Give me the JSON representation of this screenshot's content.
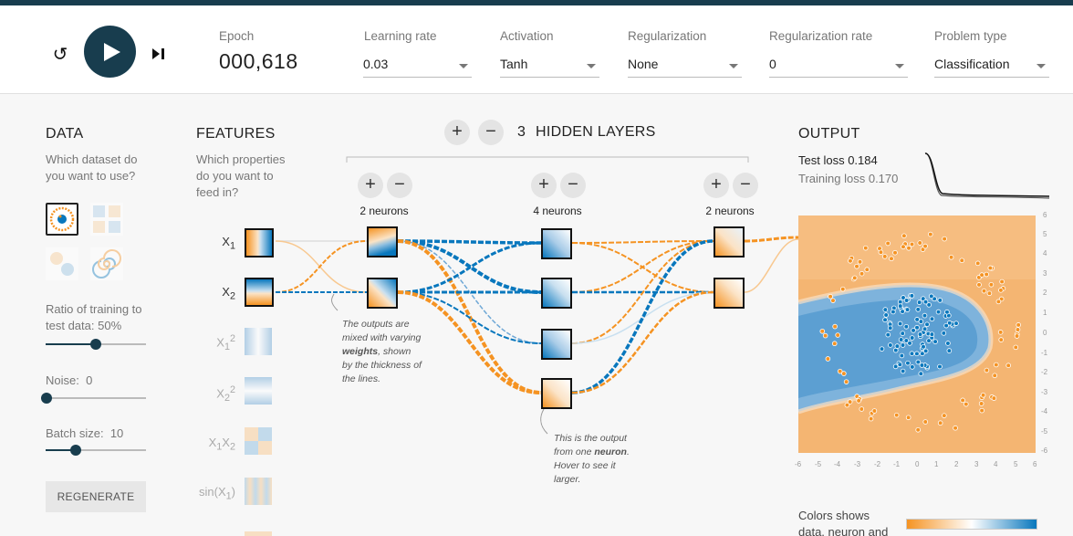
{
  "header": {
    "epoch_label": "Epoch",
    "epoch_value": "000,618",
    "learning_rate": {
      "label": "Learning rate",
      "value": "0.03"
    },
    "activation": {
      "label": "Activation",
      "value": "Tanh"
    },
    "regularization": {
      "label": "Regularization",
      "value": "None"
    },
    "regularization_rate": {
      "label": "Regularization rate",
      "value": "0"
    },
    "problem_type": {
      "label": "Problem type",
      "value": "Classification"
    }
  },
  "data_panel": {
    "title": "DATA",
    "question": "Which dataset do you want to use?",
    "ratio_label": "Ratio of training to test data:",
    "ratio_value": "50%",
    "ratio_fraction": 0.5,
    "noise_label": "Noise:",
    "noise_value": "0",
    "noise_fraction": 0,
    "batch_label": "Batch size:",
    "batch_value": "10",
    "batch_fraction": 0.3,
    "regenerate": "REGENERATE"
  },
  "features_panel": {
    "title": "FEATURES",
    "question": "Which properties do you want to feed in?",
    "features": [
      {
        "base": "X",
        "sub": "1",
        "sup": "",
        "active": true
      },
      {
        "base": "X",
        "sub": "2",
        "sup": "",
        "active": true
      },
      {
        "base": "X",
        "sub": "1",
        "sup": "2",
        "active": false
      },
      {
        "base": "X",
        "sub": "2",
        "sup": "2",
        "active": false
      },
      {
        "base": "X",
        "sub": "1",
        "base2": "X",
        "sub2": "2",
        "active": false
      },
      {
        "base": "sin(X",
        "sub": "1",
        "tail": ")",
        "active": false
      }
    ]
  },
  "network": {
    "hidden_layers_count": "3",
    "hidden_layers_label": "HIDDEN LAYERS",
    "layers": [
      {
        "neurons_label": "2 neurons"
      },
      {
        "neurons_label": "4 neurons"
      },
      {
        "neurons_label": "2 neurons"
      }
    ],
    "note_weights": [
      "The outputs are",
      "mixed with varying",
      "weights",
      ", shown",
      "by the thickness of",
      "the lines."
    ],
    "note_neuron": [
      "This is the output",
      "from one ",
      "neuron",
      ".",
      "Hover to see it",
      "larger."
    ]
  },
  "output_panel": {
    "title": "OUTPUT",
    "test_loss_label": "Test loss",
    "test_loss_value": "0.184",
    "training_loss_label": "Training loss",
    "training_loss_value": "0.170",
    "y_ticks": [
      "6",
      "5",
      "4",
      "3",
      "2",
      "1",
      "0",
      "-1",
      "-2",
      "-3",
      "-4",
      "-5",
      "-6"
    ],
    "x_ticks": [
      "-6",
      "-5",
      "-4",
      "-3",
      "-2",
      "-1",
      "0",
      "1",
      "2",
      "3",
      "4",
      "5",
      "6"
    ],
    "colors_note": "Colors shows data, neuron and"
  },
  "colors": {
    "orange": "#f59322",
    "blue": "#0877bd",
    "dark": "#183d4e"
  }
}
